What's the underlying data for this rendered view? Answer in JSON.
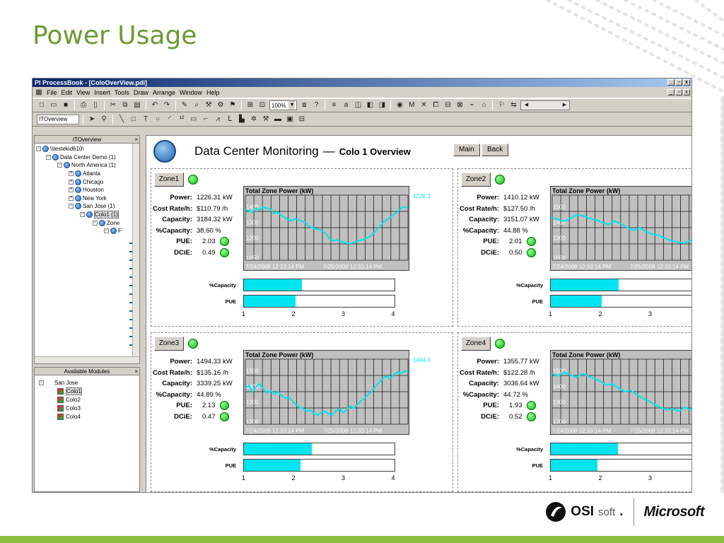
{
  "slide": {
    "title": "Power Usage",
    "logo_osi_main": "OSI",
    "logo_osi_soft": "soft",
    "logo_osi_dot": ".",
    "logo_microsoft": "Microsoft",
    "accent": "#6a9b32",
    "bar_color": "#8dc13f"
  },
  "window": {
    "title": "PI ProcessBook - [ColoOverView.pdi]",
    "menu": [
      "File",
      "Edit",
      "View",
      "Insert",
      "Tools",
      "Draw",
      "Arrange",
      "Window",
      "Help"
    ],
    "zoom": "100%",
    "tool_combo": "ITOverview"
  },
  "tree_pane": {
    "title": "ITOverview",
    "nodes": [
      "\\\\testekid610\\",
      "Data Center Demo (1)",
      "North America (1)",
      "Atlanta",
      "Chicago",
      "Houston",
      "New York",
      "San Jose (1)",
      "Colo1 (1)",
      "Zone",
      "F"
    ]
  },
  "modules_pane": {
    "title": "Available Modules",
    "root": "San Jose",
    "items": [
      "Colo1",
      "Colo2",
      "Colo3",
      "Colo4"
    ]
  },
  "main": {
    "title": "Data Center Monitoring",
    "dash": "—",
    "subtitle": "Colo 1  Overview",
    "btn_main": "Main",
    "btn_back": "Back"
  },
  "labels": {
    "power": "Power:",
    "cost": "Cost Rate/h:",
    "capacity": "Capacity:",
    "pct": "%Capacity:",
    "pue": "PUE:",
    "dcie": "DCiE:",
    "bar_capacity": "%Capacity",
    "bar_pue": "PUE",
    "chart_title": "Total Zone Power (kW)",
    "t_start": "7/24/2008 12:33:14 PM",
    "t_end": "7/25/2008 12:33:14 PM"
  },
  "zones": [
    {
      "name": "Zone1",
      "power": "1226.31 kW",
      "cost": "$110.79 /h",
      "capacity": "3184.32 kW",
      "pct": "38.60 %",
      "pue": "2.03",
      "dcie": "0.49",
      "current_label": "1226.3",
      "bar_capacity": 0.386,
      "bar_pue": 0.3433,
      "y_ticks": [
        "1400",
        "1300",
        "1200",
        "1050"
      ],
      "trend": [
        0.78,
        0.76,
        0.74,
        0.8,
        0.77,
        0.82,
        0.8,
        0.79,
        0.72,
        0.74,
        0.7,
        0.66,
        0.63,
        0.6,
        0.64,
        0.62,
        0.6,
        0.58,
        0.52,
        0.5,
        0.48,
        0.47,
        0.44,
        0.4,
        0.32,
        0.3,
        0.31,
        0.29,
        0.27,
        0.26,
        0.26,
        0.28,
        0.3,
        0.31,
        0.33,
        0.36,
        0.4,
        0.45,
        0.52,
        0.58,
        0.62,
        0.66,
        0.7,
        0.74,
        0.8,
        0.82,
        0.8
      ]
    },
    {
      "name": "Zone2",
      "power": "1410.12 kW",
      "cost": "$127.50 /h",
      "capacity": "3151.07 kW",
      "pct": "44.88 %",
      "pue": "2.01",
      "dcie": "0.50",
      "current_label": "",
      "bar_capacity": 0.4488,
      "bar_pue": 0.3367,
      "y_ticks": [
        "1500",
        "1400",
        "1300",
        "1050"
      ],
      "trend": [
        0.66,
        0.62,
        0.6,
        0.65,
        0.7,
        0.68,
        0.64,
        0.62,
        0.58,
        0.55,
        0.6,
        0.56,
        0.5,
        0.46,
        0.5,
        0.44,
        0.4,
        0.38,
        0.34,
        0.3,
        0.28,
        0.26,
        0.3,
        0.34,
        0.38,
        0.42,
        0.5
      ]
    },
    {
      "name": "Zone3",
      "power": "1494.33 kW",
      "cost": "$135.16 /h",
      "capacity": "3339.25 kW",
      "pct": "44.89 %",
      "pue": "2.13",
      "dcie": "0.47",
      "current_label": "1494.3",
      "bar_capacity": 0.4489,
      "bar_pue": 0.3767,
      "y_ticks": [
        "1500",
        "1400",
        "1300",
        "1200"
      ],
      "trend": [
        0.55,
        0.6,
        0.5,
        0.58,
        0.62,
        0.54,
        0.48,
        0.52,
        0.46,
        0.5,
        0.44,
        0.4,
        0.42,
        0.36,
        0.3,
        0.26,
        0.24,
        0.2,
        0.22,
        0.16,
        0.14,
        0.18,
        0.2,
        0.16,
        0.14,
        0.2,
        0.24,
        0.18,
        0.22,
        0.28,
        0.24,
        0.3,
        0.36,
        0.4,
        0.46,
        0.5,
        0.58,
        0.64,
        0.7,
        0.74,
        0.7,
        0.76,
        0.8,
        0.78,
        0.82,
        0.8
      ]
    },
    {
      "name": "Zone4",
      "power": "1355.77 kW",
      "cost": "$122.28 /h",
      "capacity": "3036.64 kW",
      "pct": "44.72 %",
      "pue": "1.93",
      "dcie": "0.52",
      "current_label": "",
      "bar_capacity": 0.4472,
      "bar_pue": 0.31,
      "y_ticks": [
        "1500",
        "1400",
        "1300",
        "1200"
      ],
      "trend": [
        0.78,
        0.74,
        0.8,
        0.76,
        0.72,
        0.78,
        0.74,
        0.7,
        0.66,
        0.6,
        0.62,
        0.56,
        0.5,
        0.52,
        0.46,
        0.4,
        0.36,
        0.3,
        0.26,
        0.22,
        0.24,
        0.2,
        0.26,
        0.22,
        0.28,
        0.3,
        0.34,
        0.4
      ]
    }
  ],
  "bar_axis": [
    "1",
    "2",
    "3",
    "4"
  ],
  "colors": {
    "trend": "#00e5ef",
    "plot_bg": "#c0c0c0",
    "led": "#00c000"
  }
}
